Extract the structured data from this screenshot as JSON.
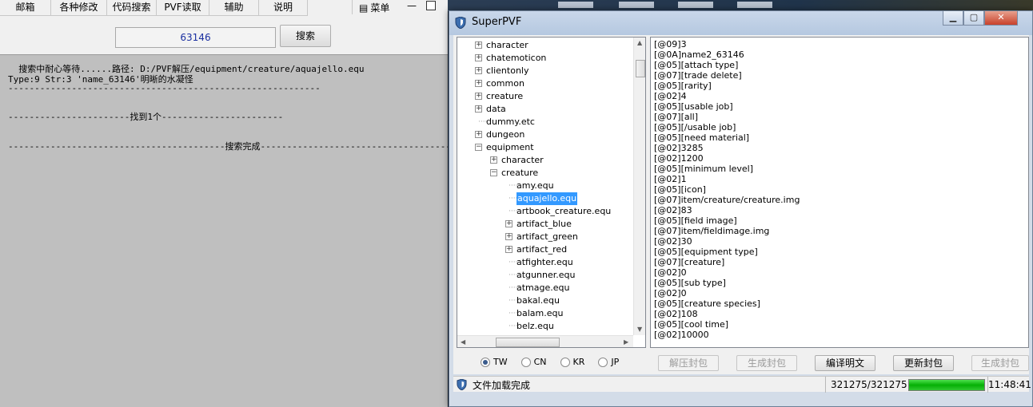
{
  "tool": {
    "menu": [
      "邮箱",
      "各种修改",
      "代码搜索",
      "PVF读取",
      "辅助",
      "说明"
    ],
    "tray_label": "菜单",
    "search_value": "63146",
    "search_button": "搜索",
    "output_lines": [
      "  搜索中耐心等待......路径: D:/PVF解压/equipment/creature/aquajello.equ",
      "Type:9 Str:3 'name_63146'明晰的水凝怪",
      "-----------------------------------------------------------",
      "",
      "-----------------------找到1个-----------------------",
      "",
      "-----------------------------------------搜索完成-----------------------------------------"
    ]
  },
  "pvf": {
    "title": "SuperPVF",
    "tree": [
      {
        "label": "character",
        "level": 0,
        "expander": "+"
      },
      {
        "label": "chatemoticon",
        "level": 0,
        "expander": "+"
      },
      {
        "label": "clientonly",
        "level": 0,
        "expander": "+"
      },
      {
        "label": "common",
        "level": 0,
        "expander": "+"
      },
      {
        "label": "creature",
        "level": 0,
        "expander": "+"
      },
      {
        "label": "data",
        "level": 0,
        "expander": "+"
      },
      {
        "label": "dummy.etc",
        "level": 0,
        "expander": ""
      },
      {
        "label": "dungeon",
        "level": 0,
        "expander": "+"
      },
      {
        "label": "equipment",
        "level": 0,
        "expander": "-"
      },
      {
        "label": "character",
        "level": 1,
        "expander": "+"
      },
      {
        "label": "creature",
        "level": 1,
        "expander": "-"
      },
      {
        "label": "amy.equ",
        "level": 2,
        "expander": ""
      },
      {
        "label": "aquajello.equ",
        "level": 2,
        "expander": "",
        "selected": true
      },
      {
        "label": "artbook_creature.equ",
        "level": 2,
        "expander": ""
      },
      {
        "label": "artifact_blue",
        "level": 2,
        "expander": "+"
      },
      {
        "label": "artifact_green",
        "level": 2,
        "expander": "+"
      },
      {
        "label": "artifact_red",
        "level": 2,
        "expander": "+"
      },
      {
        "label": "atfighter.equ",
        "level": 2,
        "expander": ""
      },
      {
        "label": "atgunner.equ",
        "level": 2,
        "expander": ""
      },
      {
        "label": "atmage.equ",
        "level": 2,
        "expander": ""
      },
      {
        "label": "bakal.equ",
        "level": 2,
        "expander": ""
      },
      {
        "label": "balam.equ",
        "level": 2,
        "expander": ""
      },
      {
        "label": "belz.equ",
        "level": 2,
        "expander": ""
      }
    ],
    "content_lines": [
      "[@09]3",
      "[@0A]name2_63146",
      "[@05][attach type]",
      "[@07][trade delete]",
      "[@05][rarity]",
      "[@02]4",
      "[@05][usable job]",
      "[@07][all]",
      "[@05][/usable job]",
      "[@05][need material]",
      "[@02]3285",
      "[@02]1200",
      "[@05][minimum level]",
      "[@02]1",
      "[@05][icon]",
      "[@07]item/creature/creature.img",
      "[@02]83",
      "[@05][field image]",
      "[@07]item/fieldimage.img",
      "[@02]30",
      "[@05][equipment type]",
      "[@07][creature]",
      "[@02]0",
      "[@05][sub type]",
      "[@02]0",
      "[@05][creature species]",
      "[@02]108",
      "[@05][cool time]",
      "[@02]10000"
    ],
    "regions": [
      {
        "label": "TW",
        "checked": true
      },
      {
        "label": "CN",
        "checked": false
      },
      {
        "label": "KR",
        "checked": false
      },
      {
        "label": "JP",
        "checked": false
      }
    ],
    "buttons": {
      "unpack": "解压封包",
      "gen1": "生成封包",
      "compile": "编译明文",
      "update": "更新封包",
      "gen2": "生成封包"
    },
    "status": {
      "text": "文件加载完成",
      "count": "321275/321275",
      "progress_fraction": 1.0,
      "time": "11:48:41"
    }
  }
}
